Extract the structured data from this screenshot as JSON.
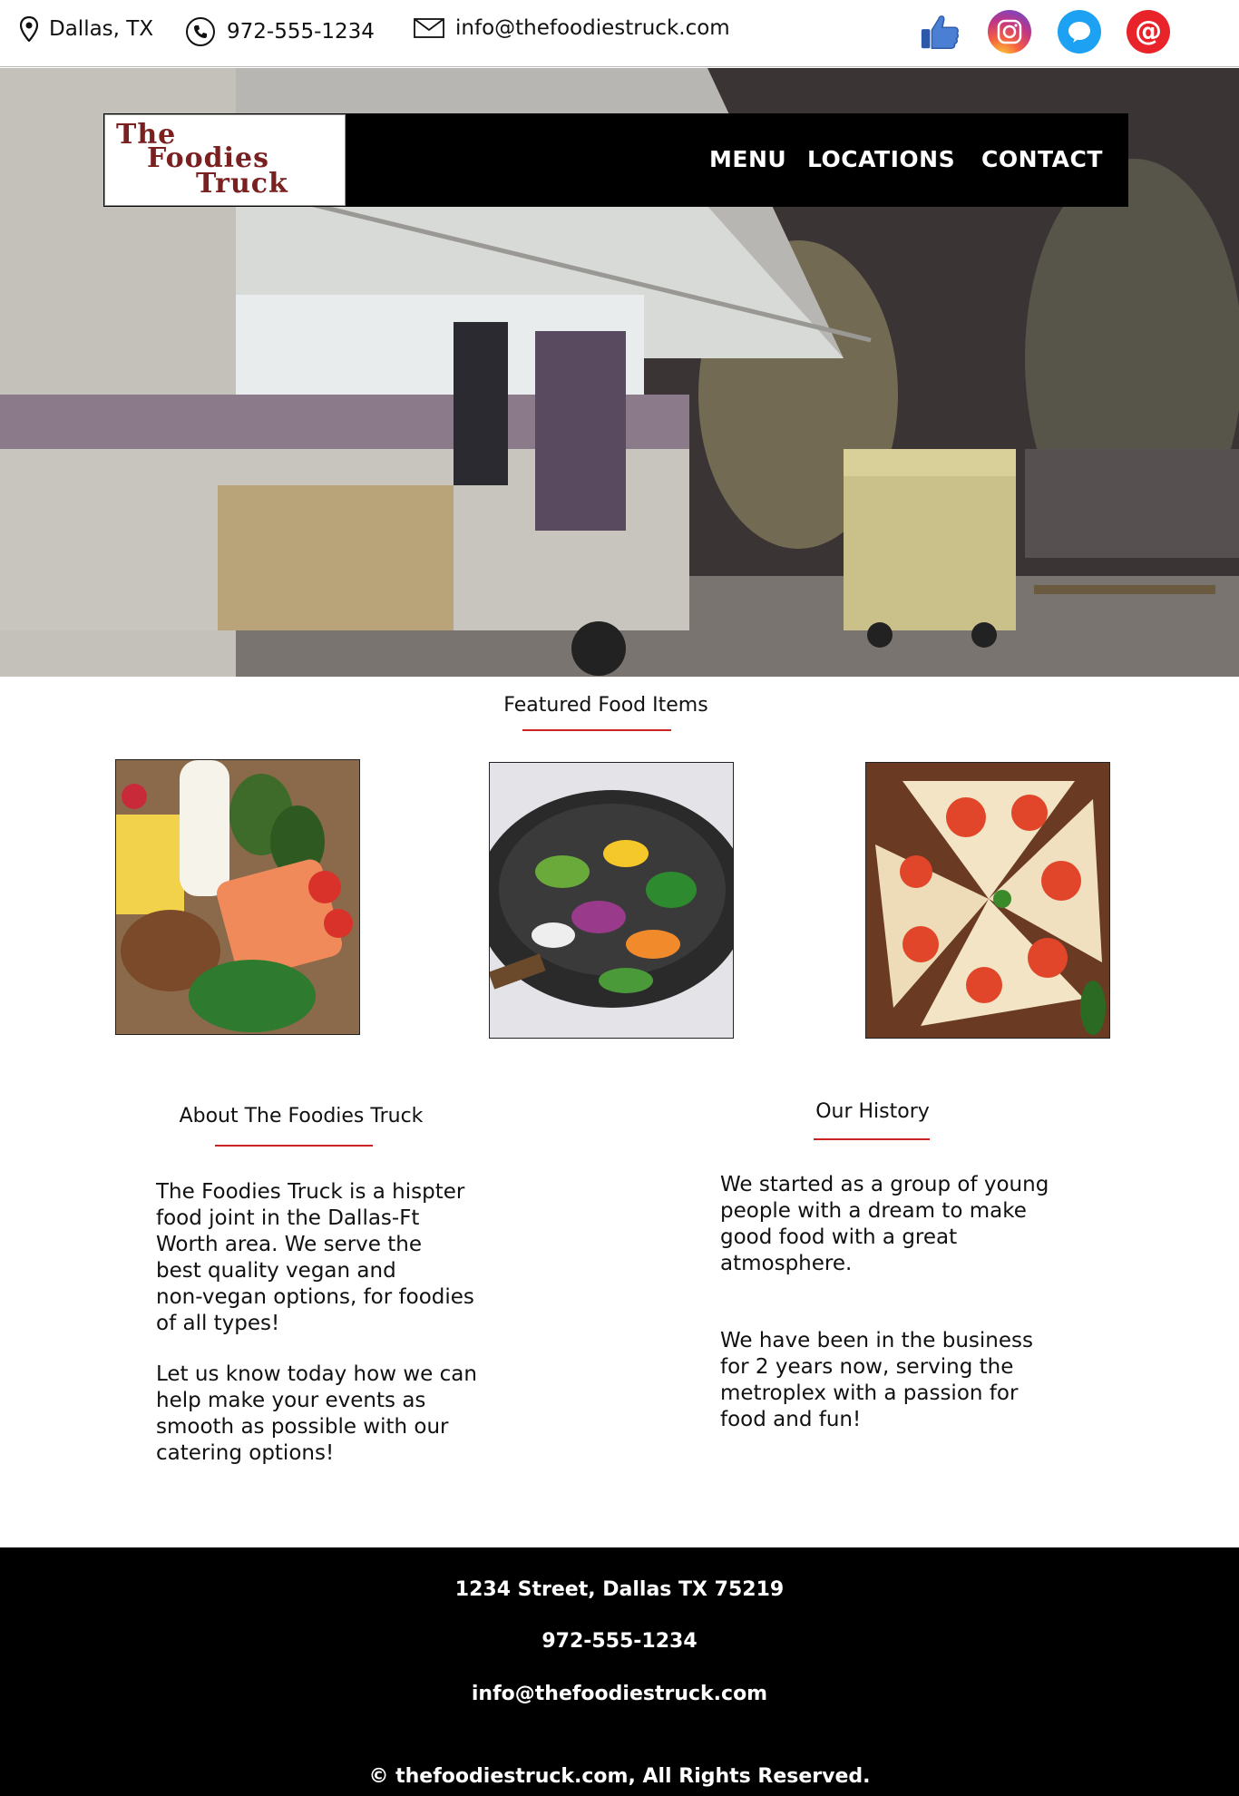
{
  "topbar": {
    "location": "Dallas, TX",
    "phone": "972-555-1234",
    "email": "info@thefoodiestruck.com",
    "social_icons": [
      "facebook-like-icon",
      "instagram-icon",
      "twitter-icon",
      "email-at-icon"
    ]
  },
  "nav": {
    "logo_lines": [
      "The",
      "Foodies",
      "Truck"
    ],
    "links": [
      "MENU",
      "LOCATIONS",
      "CONTACT"
    ]
  },
  "featured": {
    "title": "Featured Food Items",
    "images": [
      "healthy-groceries",
      "vegetable-stir-fry",
      "tomato-pizza"
    ]
  },
  "about": {
    "title": "About The Foodies Truck",
    "lines_p1": [
      "The Foodies Truck is a hispter",
      "food joint in the Dallas-Ft",
      "Worth area. We serve the",
      "best quality vegan and",
      "non-vegan options, for foodies",
      "of all types!"
    ],
    "lines_p2": [
      "Let us know today how we can",
      "help make your events as",
      "smooth as possible with our",
      "catering options!"
    ]
  },
  "history": {
    "title": "Our History",
    "lines_p1": [
      "We started as a group of young",
      "people with a dream to make",
      "good food with a great",
      "atmosphere."
    ],
    "lines_p2": [
      "We have been in the business",
      "for 2 years now, serving the",
      "metroplex with a passion for",
      "food and fun!"
    ]
  },
  "footer": {
    "address": "1234 Street, Dallas TX 75219",
    "phone": "972-555-1234",
    "email": "info@thefoodiestruck.com",
    "copyright": "© thefoodiestruck.com, All Rights Reserved."
  },
  "colors": {
    "accent_red": "#cc2222",
    "logo_text": "#7a2020",
    "nav_bg": "#000000",
    "footer_bg": "#000000"
  }
}
